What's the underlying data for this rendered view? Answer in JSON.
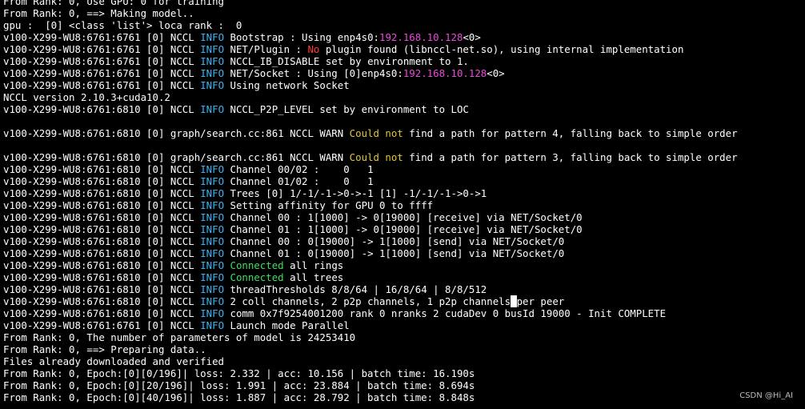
{
  "terminal": {
    "lines": [
      [
        {
          "t": "From Rank: 0, Use GPU: 0 for training",
          "c": ""
        }
      ],
      [
        {
          "t": "From Rank: 0, ==> Making model..",
          "c": ""
        }
      ],
      [
        {
          "t": "gpu :  [0] <class 'list'> loca rank :  0",
          "c": ""
        }
      ],
      [
        {
          "t": "v100-X299-WU8:6761:6761 [0] NCCL ",
          "c": ""
        },
        {
          "t": "INFO",
          "c": "info"
        },
        {
          "t": " Bootstrap : Using enp4s0:",
          "c": ""
        },
        {
          "t": "192.168.10.128",
          "c": "mag"
        },
        {
          "t": "<0>",
          "c": ""
        }
      ],
      [
        {
          "t": "v100-X299-WU8:6761:6761 [0] NCCL ",
          "c": ""
        },
        {
          "t": "INFO",
          "c": "info"
        },
        {
          "t": " NET/Plugin : ",
          "c": ""
        },
        {
          "t": "No",
          "c": "red"
        },
        {
          "t": " plugin found (libnccl-net.so), using internal implementation",
          "c": ""
        }
      ],
      [
        {
          "t": "v100-X299-WU8:6761:6761 [0] NCCL ",
          "c": ""
        },
        {
          "t": "INFO",
          "c": "info"
        },
        {
          "t": " NCCL_IB_DISABLE set by environment to 1.",
          "c": ""
        }
      ],
      [
        {
          "t": "v100-X299-WU8:6761:6761 [0] NCCL ",
          "c": ""
        },
        {
          "t": "INFO",
          "c": "info"
        },
        {
          "t": " NET/Socket : Using [0]enp4s0:",
          "c": ""
        },
        {
          "t": "192.168.10.128",
          "c": "mag"
        },
        {
          "t": "<0>",
          "c": ""
        }
      ],
      [
        {
          "t": "v100-X299-WU8:6761:6761 [0] NCCL ",
          "c": ""
        },
        {
          "t": "INFO",
          "c": "info"
        },
        {
          "t": " Using network Socket",
          "c": ""
        }
      ],
      [
        {
          "t": "NCCL version 2.10.3+cuda10.2",
          "c": ""
        }
      ],
      [
        {
          "t": "v100-X299-WU8:6761:6810 [0] NCCL ",
          "c": ""
        },
        {
          "t": "INFO",
          "c": "info"
        },
        {
          "t": " NCCL_P2P_LEVEL set by environment to LOC",
          "c": ""
        }
      ],
      [
        {
          "t": "",
          "c": ""
        }
      ],
      [
        {
          "t": "v100-X299-WU8:6761:6810 [0] graph/search.cc:861 NCCL WARN ",
          "c": ""
        },
        {
          "t": "Could not",
          "c": "yel"
        },
        {
          "t": " find a path for pattern 4, falling back to simple order",
          "c": ""
        }
      ],
      [
        {
          "t": "",
          "c": ""
        }
      ],
      [
        {
          "t": "v100-X299-WU8:6761:6810 [0] graph/search.cc:861 NCCL WARN ",
          "c": ""
        },
        {
          "t": "Could not",
          "c": "yel"
        },
        {
          "t": " find a path for pattern 3, falling back to simple order",
          "c": ""
        }
      ],
      [
        {
          "t": "v100-X299-WU8:6761:6810 [0] NCCL ",
          "c": ""
        },
        {
          "t": "INFO",
          "c": "info"
        },
        {
          "t": " Channel 00/02 :    0   1",
          "c": ""
        }
      ],
      [
        {
          "t": "v100-X299-WU8:6761:6810 [0] NCCL ",
          "c": ""
        },
        {
          "t": "INFO",
          "c": "info"
        },
        {
          "t": " Channel 01/02 :    0   1",
          "c": ""
        }
      ],
      [
        {
          "t": "v100-X299-WU8:6761:6810 [0] NCCL ",
          "c": ""
        },
        {
          "t": "INFO",
          "c": "info"
        },
        {
          "t": " Trees [0] 1/-1/-1->0->-1 [1] -1/-1/-1->0->1",
          "c": ""
        }
      ],
      [
        {
          "t": "v100-X299-WU8:6761:6810 [0] NCCL ",
          "c": ""
        },
        {
          "t": "INFO",
          "c": "info"
        },
        {
          "t": " Setting affinity for GPU 0 to ffff",
          "c": ""
        }
      ],
      [
        {
          "t": "v100-X299-WU8:6761:6810 [0] NCCL ",
          "c": ""
        },
        {
          "t": "INFO",
          "c": "info"
        },
        {
          "t": " Channel 00 : 1[1000] -> 0[19000] [receive] via NET/Socket/0",
          "c": ""
        }
      ],
      [
        {
          "t": "v100-X299-WU8:6761:6810 [0] NCCL ",
          "c": ""
        },
        {
          "t": "INFO",
          "c": "info"
        },
        {
          "t": " Channel 01 : 1[1000] -> 0[19000] [receive] via NET/Socket/0",
          "c": ""
        }
      ],
      [
        {
          "t": "v100-X299-WU8:6761:6810 [0] NCCL ",
          "c": ""
        },
        {
          "t": "INFO",
          "c": "info"
        },
        {
          "t": " Channel 00 : 0[19000] -> 1[1000] [send] via NET/Socket/0",
          "c": ""
        }
      ],
      [
        {
          "t": "v100-X299-WU8:6761:6810 [0] NCCL ",
          "c": ""
        },
        {
          "t": "INFO",
          "c": "info"
        },
        {
          "t": " Channel 01 : 0[19000] -> 1[1000] [send] via NET/Socket/0",
          "c": ""
        }
      ],
      [
        {
          "t": "v100-X299-WU8:6761:6810 [0] NCCL ",
          "c": ""
        },
        {
          "t": "INFO",
          "c": "info"
        },
        {
          "t": " ",
          "c": ""
        },
        {
          "t": "Connected",
          "c": "grn"
        },
        {
          "t": " all rings",
          "c": ""
        }
      ],
      [
        {
          "t": "v100-X299-WU8:6761:6810 [0] NCCL ",
          "c": ""
        },
        {
          "t": "INFO",
          "c": "info"
        },
        {
          "t": " ",
          "c": ""
        },
        {
          "t": "Connected",
          "c": "grn"
        },
        {
          "t": " all trees",
          "c": ""
        }
      ],
      [
        {
          "t": "v100-X299-WU8:6761:6810 [0] NCCL ",
          "c": ""
        },
        {
          "t": "INFO",
          "c": "info"
        },
        {
          "t": " threadThresholds 8/8/64 | 16/8/64 | 8/8/512",
          "c": ""
        }
      ],
      [
        {
          "t": "v100-X299-WU8:6761:6810 [0] NCCL ",
          "c": ""
        },
        {
          "t": "INFO",
          "c": "info"
        },
        {
          "t": " 2 coll channels, 2 p2p channels, 1 p2p channels",
          "c": ""
        },
        {
          "t": " ",
          "c": "cursor"
        },
        {
          "t": "per peer",
          "c": ""
        }
      ],
      [
        {
          "t": "v100-X299-WU8:6761:6810 [0] NCCL ",
          "c": ""
        },
        {
          "t": "INFO",
          "c": "info"
        },
        {
          "t": " comm 0x7f9254001200 rank 0 nranks 2 cudaDev 0 busId 19000 - Init COMPLETE",
          "c": ""
        }
      ],
      [
        {
          "t": "v100-X299-WU8:6761:6761 [0] NCCL ",
          "c": ""
        },
        {
          "t": "INFO",
          "c": "info"
        },
        {
          "t": " Launch mode Parallel",
          "c": ""
        }
      ],
      [
        {
          "t": "From Rank: 0, The number of parameters of model is 24253410",
          "c": ""
        }
      ],
      [
        {
          "t": "From Rank: 0, ==> Preparing data..",
          "c": ""
        }
      ],
      [
        {
          "t": "Files already downloaded and verified",
          "c": ""
        }
      ],
      [
        {
          "t": "From Rank: 0, Epoch:[0][0/196]| loss: 2.332 | acc: 10.156 | batch time: 16.190s",
          "c": ""
        }
      ],
      [
        {
          "t": "From Rank: 0, Epoch:[0][20/196]| loss: 1.991 | acc: 23.884 | batch time: 8.694s",
          "c": ""
        }
      ],
      [
        {
          "t": "From Rank: 0, Epoch:[0][40/196]| loss: 1.887 | acc: 28.792 | batch time: 8.848s",
          "c": ""
        }
      ]
    ]
  },
  "watermark": "CSDN @Hi_AI",
  "colors": {
    "background": "#000000",
    "text": "#ffffff",
    "info": "#3fb3f1",
    "ip": "#e94ad9",
    "no": "#ff3b3b",
    "could_not": "#e3c436",
    "connected": "#3fdc62"
  }
}
